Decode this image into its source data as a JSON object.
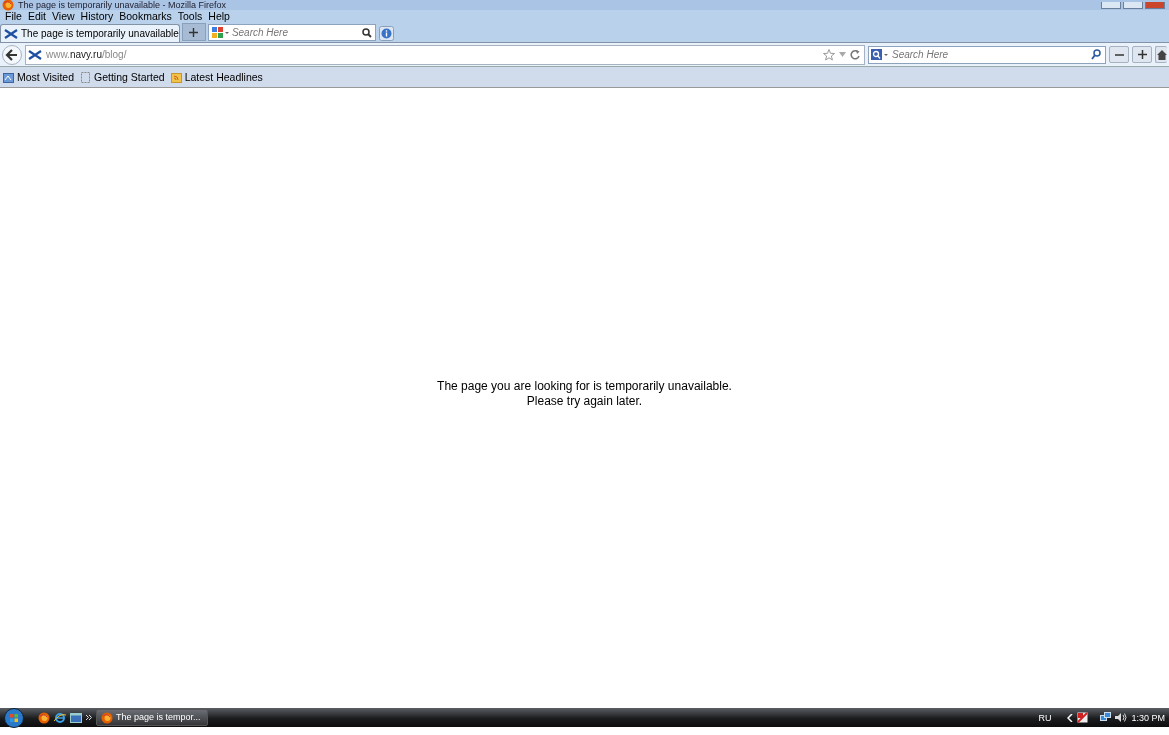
{
  "window": {
    "title": "The page is temporarily unavailable - Mozilla Firefox"
  },
  "menu": [
    "File",
    "Edit",
    "View",
    "History",
    "Bookmarks",
    "Tools",
    "Help"
  ],
  "tabs": [
    {
      "label": "The page is temporarily unavailable",
      "selected": true
    }
  ],
  "tab_search": {
    "placeholder": "Search Here"
  },
  "address": {
    "url": "www.**navy.ru**/blog/"
  },
  "search": {
    "placeholder": "Search Here"
  },
  "bookmarks": [
    {
      "label": "Most Visited",
      "kind": "smart"
    },
    {
      "label": "Getting Started",
      "kind": "page"
    },
    {
      "label": "Latest Headlines",
      "kind": "feed"
    }
  ],
  "message": [
    "The page you are looking for is temporarily unavailable.",
    "Please try again later."
  ],
  "taskbar": {
    "windows": [
      {
        "label": "The page is tempor...",
        "selected": true
      }
    ],
    "language": "RU",
    "clock": "1:30 PM"
  }
}
